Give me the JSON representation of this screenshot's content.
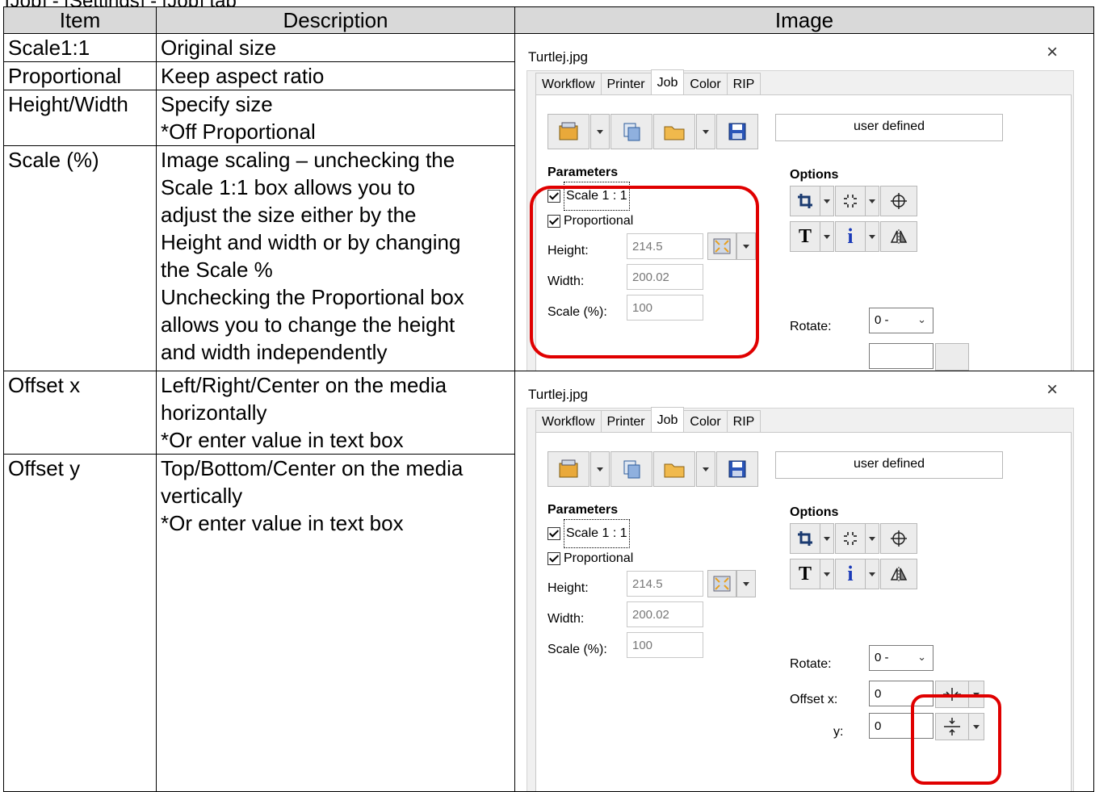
{
  "breadcrumb": "[Job] - [Settings] - [Job] tab",
  "headers": {
    "item": "Item",
    "description": "Description",
    "image": "Image"
  },
  "rows": [
    {
      "item": "Scale1:1",
      "description": "Original size"
    },
    {
      "item": "Proportional",
      "description": "Keep aspect ratio"
    },
    {
      "item": "Height/Width",
      "description": "Specify size\n*Off Proportional"
    },
    {
      "item": "Scale (%)",
      "description": "Image scaling – unchecking the\nScale 1:1 box allows you to\nadjust the size either by the\nHeight and width or by changing\nthe Scale %\nUnchecking the Proportional box\nallows you to change the height\nand width independently"
    },
    {
      "item": "Offset x",
      "description": "Left/Right/Center on the media\nhorizontally\n*Or enter value in text box"
    },
    {
      "item": "Offset y",
      "description": "Top/Bottom/Center on the media\nvertically\n*Or enter value in text box"
    }
  ],
  "dialog": {
    "title": "Turtlej.jpg",
    "close": "×",
    "tabs": [
      "Workflow",
      "Printer",
      "Job",
      "Color",
      "RIP"
    ],
    "active_tab": "Job",
    "preset": "user defined",
    "parameters_label": "Parameters",
    "options_label": "Options",
    "scale_label": "Scale 1 : 1",
    "proportional_label": "Proportional",
    "height_label": "Height:",
    "height_value": "214.5",
    "width_label": "Width:",
    "width_value": "200.02",
    "scale_pct_label": "Scale (%):",
    "scale_pct_value": "100",
    "rotate_label": "Rotate:",
    "rotate_value": "0 -",
    "offset_x_label": "Offset x:",
    "offset_x_value": "0",
    "offset_y_label": "y:",
    "offset_y_value": "0"
  },
  "colors": {
    "header_bg": "#d9d9d9",
    "highlight": "#e00000",
    "dialog_bg": "#f0f0f0"
  }
}
